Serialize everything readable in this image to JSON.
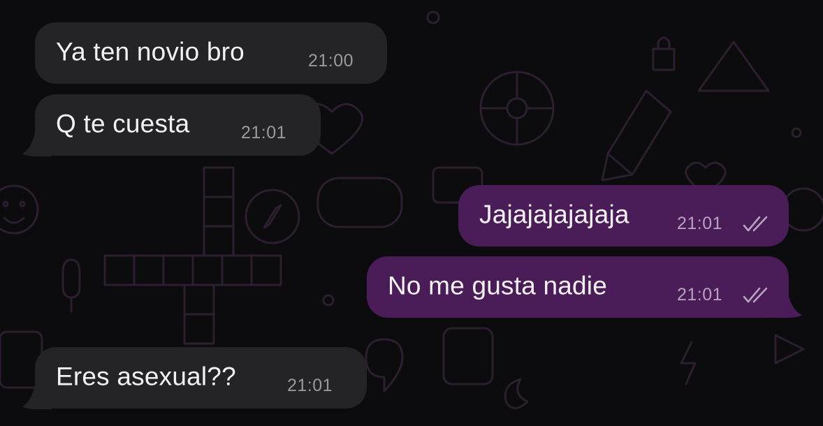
{
  "chat": {
    "messages": [
      {
        "text": "Ya ten novio bro",
        "time": "21:00",
        "direction": "incoming"
      },
      {
        "text": "Q te cuesta",
        "time": "21:01",
        "direction": "incoming"
      },
      {
        "text": "Jajajajajajaja",
        "time": "21:01",
        "direction": "outgoing",
        "status": "read"
      },
      {
        "text": "No me gusta nadie",
        "time": "21:01",
        "direction": "outgoing",
        "status": "read"
      },
      {
        "text": "Eres asexual??",
        "time": "21:01",
        "direction": "incoming"
      }
    ]
  },
  "colors": {
    "background": "#0c0b0d",
    "incoming_bubble": "#242426",
    "outgoing_bubble": "#4a1d58",
    "doodle": "#2c1f30"
  }
}
